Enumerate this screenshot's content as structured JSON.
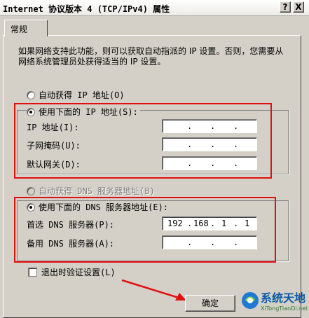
{
  "window": {
    "title": "Internet 协议版本 4 (TCP/IPv4) 属性",
    "help_label": "?",
    "close_label": "X"
  },
  "tabs": [
    {
      "label": "常规"
    }
  ],
  "description": "如果网络支持此功能，则可以获取自动指派的 IP 设置。否则，您需要从网络系统管理员处获得适当的 IP 设置。",
  "ip_section": {
    "auto_label": "自动获得 IP 地址(O)",
    "manual_label": "使用下面的 IP 地址(S):",
    "selected": "manual",
    "fields": [
      {
        "label": "IP 地址(I):",
        "octets": [
          "",
          "",
          "",
          ""
        ]
      },
      {
        "label": "子网掩码(U):",
        "octets": [
          "",
          "",
          "",
          ""
        ]
      },
      {
        "label": "默认网关(D):",
        "octets": [
          "",
          "",
          "",
          ""
        ]
      }
    ]
  },
  "dns_section": {
    "auto_label": "自动获得 DNS 服务器地址(B)",
    "manual_label": "使用下面的 DNS 服务器地址(E):",
    "selected": "manual",
    "fields": [
      {
        "label": "首选 DNS 服务器(P):",
        "octets": [
          "192",
          "168",
          "1",
          "1"
        ]
      },
      {
        "label": "备用 DNS 服务器(A):",
        "octets": [
          "",
          "",
          "",
          ""
        ]
      }
    ]
  },
  "validate_checkbox": {
    "label": "退出时验证设置(L)",
    "checked": false
  },
  "ok_button": {
    "label": "确定"
  },
  "watermark": {
    "name": "系统天地",
    "url": "XiTongTianDi.net"
  },
  "colors": {
    "highlight": "#e01010",
    "face": "#d4d0c8"
  }
}
